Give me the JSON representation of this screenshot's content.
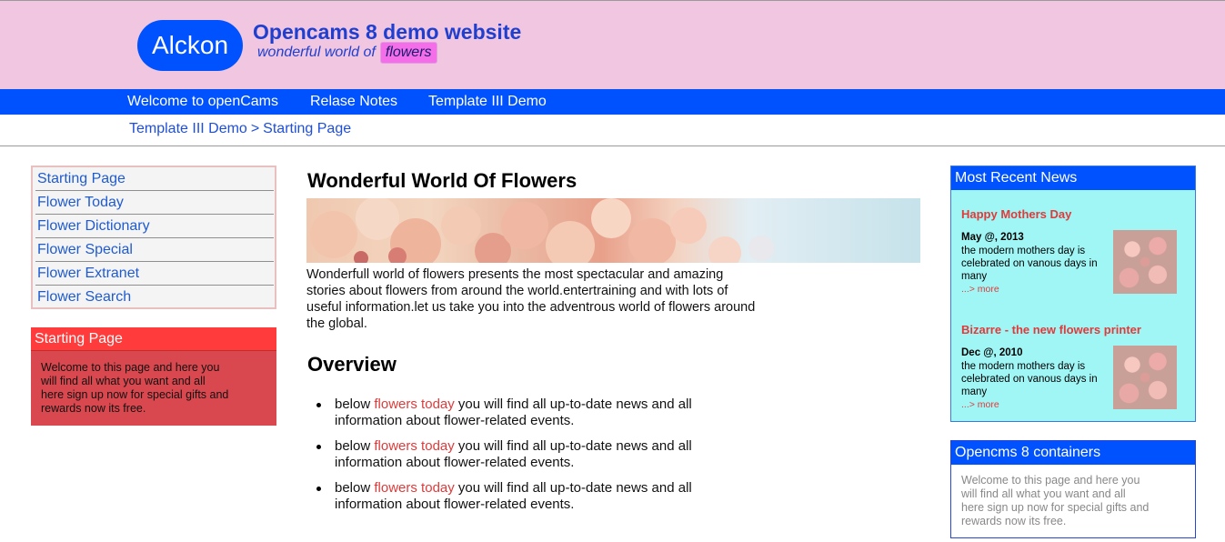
{
  "header": {
    "logo": "Alckon",
    "title": "Opencams 8 demo website",
    "tagline": "wonderful world of",
    "tag_highlight": "flowers"
  },
  "nav": [
    {
      "label": "Welcome to openCams"
    },
    {
      "label": "Relase Notes"
    },
    {
      "label": "Template III Demo"
    }
  ],
  "breadcrumb": {
    "parent": "Template III Demo",
    "separator": ">",
    "current": "Starting Page"
  },
  "sidebar": {
    "items": [
      {
        "label": "Starting Page"
      },
      {
        "label": "Flower Today"
      },
      {
        "label": "Flower Dictionary"
      },
      {
        "label": "Flower Special"
      },
      {
        "label": "Flower Extranet"
      },
      {
        "label": "Flower Search"
      }
    ],
    "infobox": {
      "title": "Starting Page",
      "text": "Welcome to this page and here you will find all what you want and all here sign up now for special gifts and rewards now its free."
    }
  },
  "main": {
    "title": "Wonderful World Of Flowers",
    "intro": "Wonderfull world of flowers presents the most spectacular and amazing stories about flowers from around the world.entertraining and with lots of useful information.let us take you into the adventrous world of flowers around the global.",
    "overview_title": "Overview",
    "bullets": [
      {
        "before": "below",
        "link": "flowers today",
        "after": "you will find all up-to-date news and all information about flower-related events."
      },
      {
        "before": "below",
        "link": "flowers today",
        "after": "you will find all up-to-date news and all information about flower-related events."
      },
      {
        "before": "below",
        "link": "flowers today",
        "after": "you will find all up-to-date news and all information about flower-related events."
      }
    ]
  },
  "news": {
    "title": "Most Recent News",
    "items": [
      {
        "headline": "Happy Mothers Day",
        "date": "May @, 2013",
        "text": "the modern mothers day is celebrated on vanous days in many",
        "more": "...> more"
      },
      {
        "headline": "Bizarre - the new flowers printer",
        "date": "Dec @, 2010",
        "text": "the modern mothers day is celebrated on vanous days in many",
        "more": "...> more"
      }
    ]
  },
  "containers": {
    "title": "Opencms 8 containers",
    "text": "Welcome to this page and here you will find all what you want and all here sign up now for special gifts and rewards now its free."
  },
  "colors": {
    "header_bg": "#f0c6e0",
    "brand_blue": "#0052ff",
    "link_red": "#e03a3a",
    "news_bg": "#a0f5f5",
    "infobox_red": "#d9484f"
  }
}
